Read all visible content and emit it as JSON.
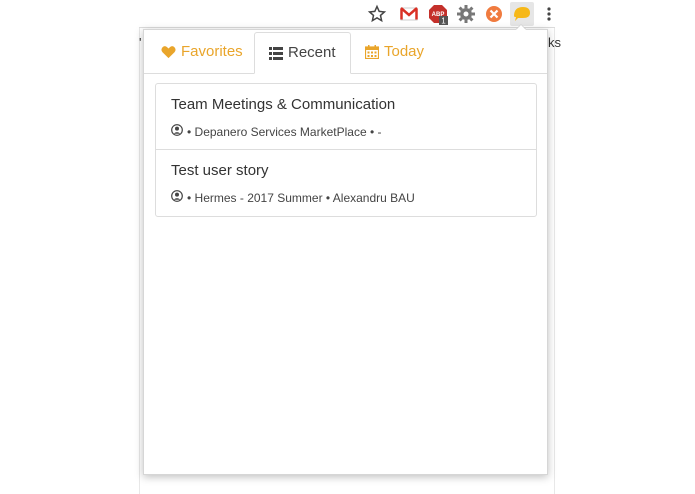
{
  "browser": {
    "page_text_left": "'",
    "page_text_right": "ks"
  },
  "tabs": [
    {
      "label": "Favorites",
      "icon": "heart-icon",
      "color": "#e9a52b"
    },
    {
      "label": "Recent",
      "icon": "list-icon",
      "active": true
    },
    {
      "label": "Today",
      "icon": "calendar-icon",
      "color": "#e9a52b"
    }
  ],
  "items": [
    {
      "title": "Team Meetings & Communication",
      "meta": "• Depanero Services MarketPlace • -"
    },
    {
      "title": "Test user story",
      "meta": "• Hermes - 2017 Summer • Alexandru BAU"
    }
  ],
  "colors": {
    "accent": "#e9a52b",
    "border": "#dddddd"
  }
}
